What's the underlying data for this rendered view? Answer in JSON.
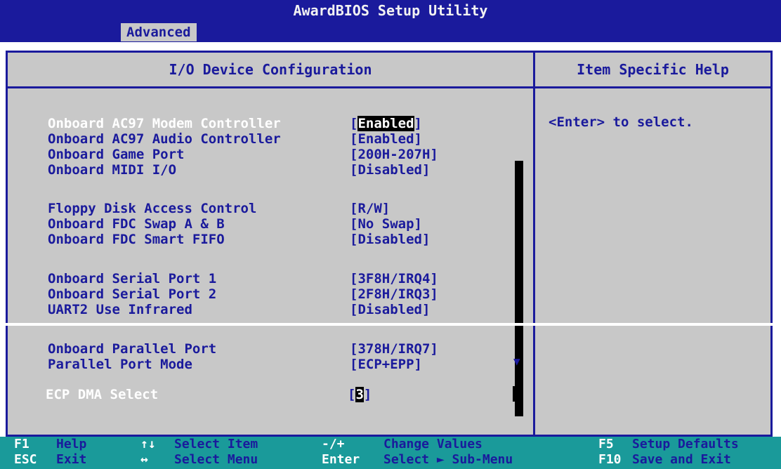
{
  "window": {
    "title": "AwardBIOS Setup Utility"
  },
  "menu": {
    "active_tab": "Advanced"
  },
  "panel": {
    "title": "I/O Device Configuration",
    "help_title": "Item Specific Help",
    "help_text": "<Enter> to select."
  },
  "items": [
    {
      "label": "Onboard AC97 Modem Controller",
      "value": "Enabled",
      "selected": true
    },
    {
      "label": "Onboard AC97 Audio Controller",
      "value": "[Enabled]"
    },
    {
      "label": "Onboard Game Port",
      "value": "[200H-207H]"
    },
    {
      "label": "Onboard MIDI I/O",
      "value": "[Disabled]"
    },
    {
      "label": "Floppy Disk Access Control",
      "value": "[R/W]"
    },
    {
      "label": "Onboard FDC Swap A & B",
      "value": "[No Swap]"
    },
    {
      "label": "Onboard FDC Smart FIFO",
      "value": "[Disabled]"
    },
    {
      "label": "Onboard Serial Port 1",
      "value": "[3F8H/IRQ4]"
    },
    {
      "label": "Onboard Serial Port 2",
      "value": "[2F8H/IRQ3]"
    },
    {
      "label": "UART2 Use Infrared",
      "value": "[Disabled]"
    },
    {
      "label": "Onboard Parallel Port",
      "value": "[378H/IRQ7]"
    },
    {
      "label": "Parallel Port Mode",
      "value": "[ECP+EPP]"
    },
    {
      "label": "ECP DMA Select",
      "value": "3",
      "selected": true
    }
  ],
  "footer": {
    "keys": [
      {
        "key": "F1",
        "desc": "Help"
      },
      {
        "key": "ESC",
        "desc": "Exit"
      },
      {
        "key": "↑↓",
        "desc": "Select Item"
      },
      {
        "key": "↔",
        "desc": "Select Menu"
      },
      {
        "key": "-/+",
        "desc": "Change Values"
      },
      {
        "key": "Enter",
        "desc": "Select ► Sub-Menu"
      },
      {
        "key": "F5",
        "desc": "Setup Defaults"
      },
      {
        "key": "F10",
        "desc": "Save and Exit"
      }
    ]
  },
  "colors": {
    "background": "#1a1a9c",
    "panel": "#c8c8c8",
    "footer": "#1a9a9a"
  }
}
